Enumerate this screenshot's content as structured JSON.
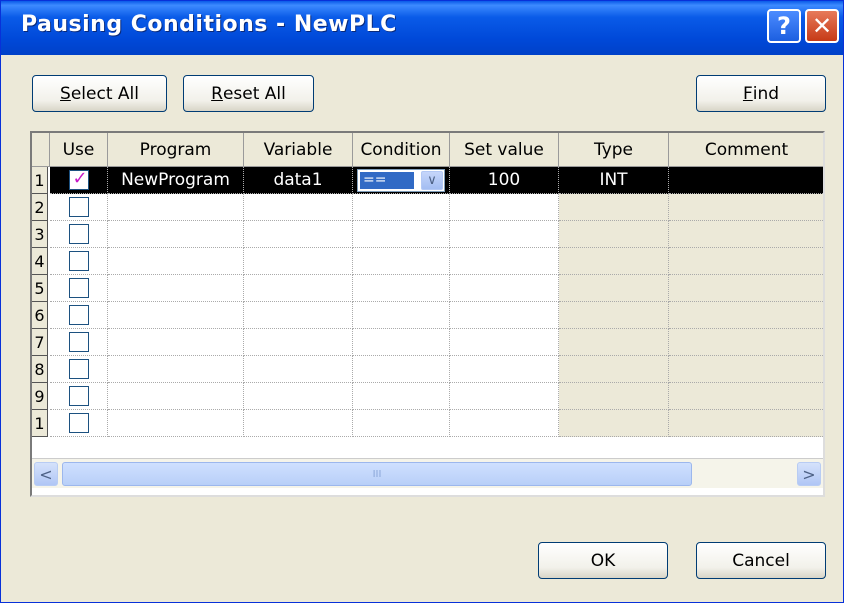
{
  "window": {
    "title": "Pausing Conditions - NewPLC",
    "help_glyph": "?",
    "close_glyph": "✕"
  },
  "toolbar": {
    "select_all_key": "S",
    "select_all_rest": "elect All",
    "reset_all_key": "R",
    "reset_all_rest": "eset All",
    "find_key": "F",
    "find_rest": "ind"
  },
  "table": {
    "headers": {
      "use": "Use",
      "program": "Program",
      "variable": "Variable",
      "condition": "Condition",
      "set_value": "Set value",
      "type": "Type",
      "comment": "Comment"
    },
    "rows": [
      {
        "num": "1",
        "use": true,
        "program": "NewProgram",
        "variable": "data1",
        "condition": "==",
        "set_value": "100",
        "type": "INT",
        "comment": ""
      },
      {
        "num": "2",
        "use": false
      },
      {
        "num": "3",
        "use": false
      },
      {
        "num": "4",
        "use": false
      },
      {
        "num": "5",
        "use": false
      },
      {
        "num": "6",
        "use": false
      },
      {
        "num": "7",
        "use": false
      },
      {
        "num": "8",
        "use": false
      },
      {
        "num": "9",
        "use": false
      },
      {
        "num": "1",
        "use": false
      }
    ]
  },
  "scrollbar": {
    "left_arrow": "<",
    "right_arrow": ">",
    "grip": "III"
  },
  "footer": {
    "ok_label": "OK",
    "cancel_label": "Cancel"
  },
  "colors": {
    "titlebar": "#0a5be8",
    "selected_row": "#000000",
    "check": "#c61ac6",
    "dialog_bg": "#ece9d8"
  }
}
